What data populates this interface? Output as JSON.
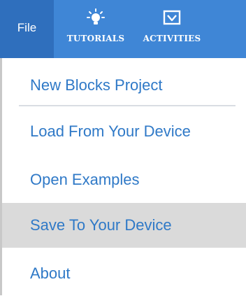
{
  "menubar": {
    "file_label": "File",
    "tutorials": {
      "label": "TUTORIALS",
      "icon": "lightbulb-icon"
    },
    "activities": {
      "label": "ACTIVITIES",
      "icon": "checkbox-icon"
    }
  },
  "file_menu": {
    "items": [
      {
        "label": "New Blocks Project"
      },
      {
        "label": "Load From Your Device"
      },
      {
        "label": "Open Examples"
      },
      {
        "label": "Save To Your Device",
        "state": "hovered"
      },
      {
        "label": "About"
      }
    ]
  },
  "colors": {
    "menubar": "#3f86d6",
    "file_tab": "#2f6fbd",
    "menu_text": "#2f79c7",
    "hover": "#dadada"
  }
}
